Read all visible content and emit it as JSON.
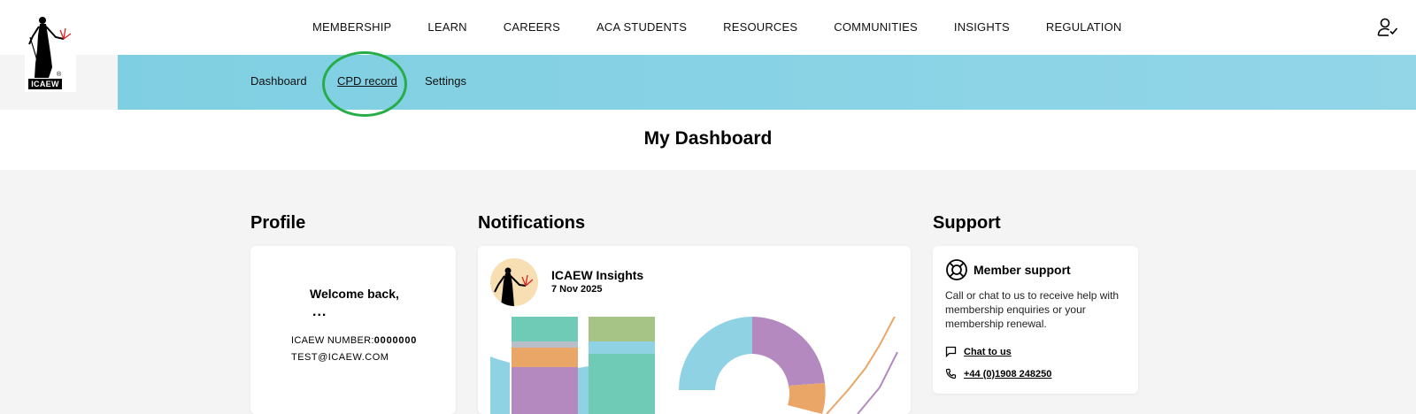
{
  "logo": {
    "text": "ICAEW",
    "icon": "figure-logo-icon"
  },
  "nav": {
    "items": [
      "MEMBERSHIP",
      "LEARN",
      "CAREERS",
      "ACA STUDENTS",
      "RESOURCES",
      "COMMUNITIES",
      "INSIGHTS",
      "REGULATION"
    ],
    "user_icon": "user-check-icon"
  },
  "subnav": {
    "items": [
      "Dashboard",
      "CPD record",
      "Settings"
    ],
    "active": "CPD record",
    "highlight_color": "#27ad47",
    "background": "#88d3e6"
  },
  "page": {
    "title": "My Dashboard"
  },
  "profile": {
    "heading": "Profile",
    "welcome": "Welcome back,",
    "name": "...",
    "number_label": "ICAEW NUMBER:",
    "number_value": "0000000",
    "email": "TEST@ICAEW.COM"
  },
  "notifications": {
    "heading": "Notifications",
    "items": [
      {
        "title": "ICAEW Insights",
        "date": "7 Nov 2025"
      }
    ]
  },
  "support": {
    "heading": "Support",
    "card_title": "Member support",
    "description": "Call or chat to us to receive help with membership enquiries or your membership renewal.",
    "chat_label": "Chat to us",
    "phone": "+44 (0)1908 248250",
    "icons": [
      "lifebuoy-icon",
      "chat-icon",
      "phone-icon"
    ]
  }
}
